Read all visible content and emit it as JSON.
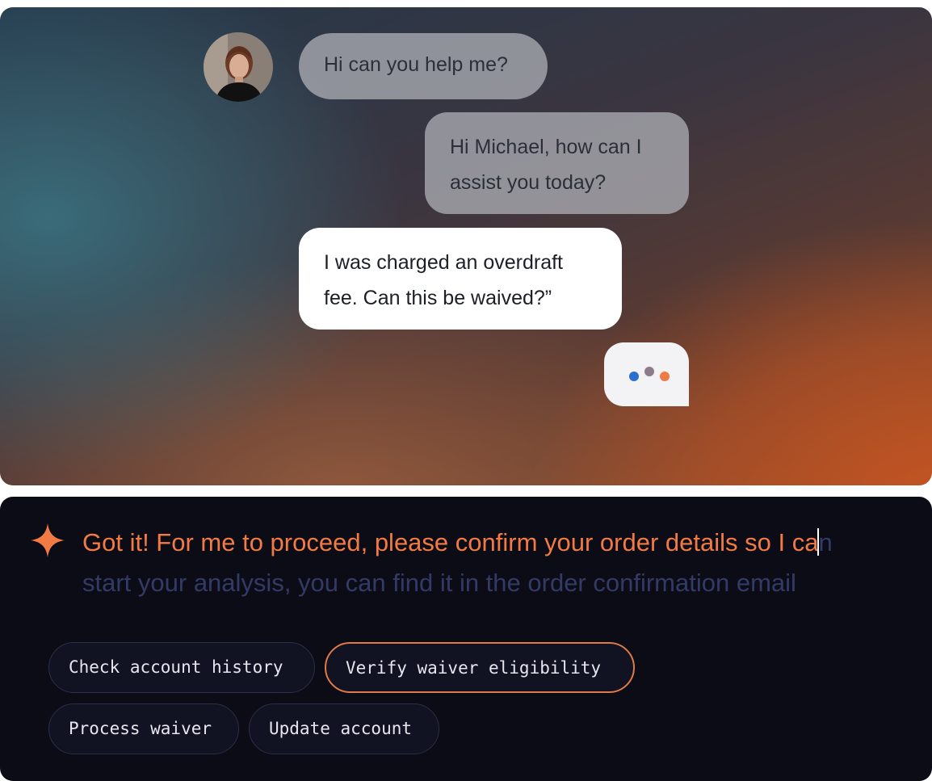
{
  "chat": {
    "avatar_icon": "user-avatar-woman-photo",
    "messages": [
      {
        "role": "customer",
        "text": "Hi can you help me?"
      },
      {
        "role": "agent",
        "text_line1": "Hi Michael, how can I",
        "text_line2": "assist you today?"
      },
      {
        "role": "customer",
        "text_line1": "I was charged an overdraft",
        "text_line2": "fee.  Can this be waived?”"
      }
    ],
    "typing_indicator": {
      "icon": "typing-dots-icon",
      "dot_colors": [
        "#2a6fd0",
        "#8d7b8a",
        "#f07a46"
      ]
    }
  },
  "assistant": {
    "icon": "sparkle-icon",
    "accent_color": "#f27a44",
    "reply_typed": "Got it! For me to proceed, please confirm your order details so I ca",
    "reply_pending_line1": "n",
    "reply_pending_line2": "start your analysis, you can find it in the order confirmation email",
    "actions": [
      {
        "label": "Check account history",
        "active": false
      },
      {
        "label": "Verify waiver eligibility",
        "active": true
      },
      {
        "label": "Process waiver",
        "active": false
      },
      {
        "label": "Update account",
        "active": false
      }
    ]
  }
}
